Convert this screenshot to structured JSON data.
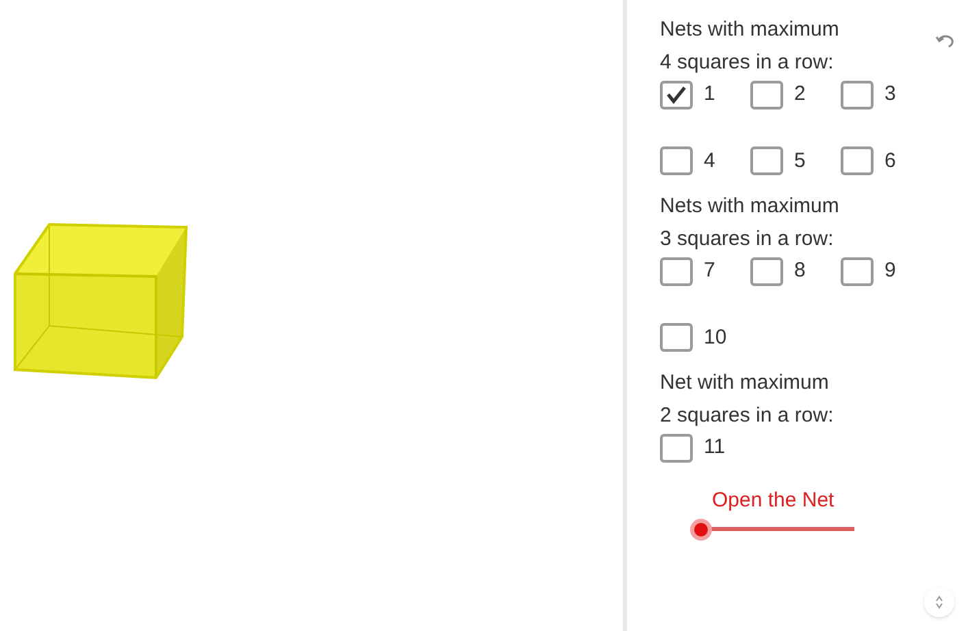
{
  "groups": [
    {
      "heading": [
        "Nets with maximum",
        "4 squares in a row:"
      ],
      "rows": [
        [
          {
            "label": "1",
            "checked": true
          },
          {
            "label": "2",
            "checked": false
          },
          {
            "label": "3",
            "checked": false
          }
        ],
        [
          {
            "label": "4",
            "checked": false
          },
          {
            "label": "5",
            "checked": false
          },
          {
            "label": "6",
            "checked": false
          }
        ]
      ]
    },
    {
      "heading": [
        "Nets with maximum",
        "3 squares in a row:"
      ],
      "rows": [
        [
          {
            "label": "7",
            "checked": false
          },
          {
            "label": "8",
            "checked": false
          },
          {
            "label": "9",
            "checked": false
          }
        ],
        [
          {
            "label": "10",
            "checked": false
          }
        ]
      ]
    },
    {
      "heading": [
        "Net with maximum",
        "2 squares in a row:"
      ],
      "rows": [
        [
          {
            "label": "11",
            "checked": false
          }
        ]
      ]
    }
  ],
  "slider": {
    "label": "Open the Net",
    "level": 0
  }
}
